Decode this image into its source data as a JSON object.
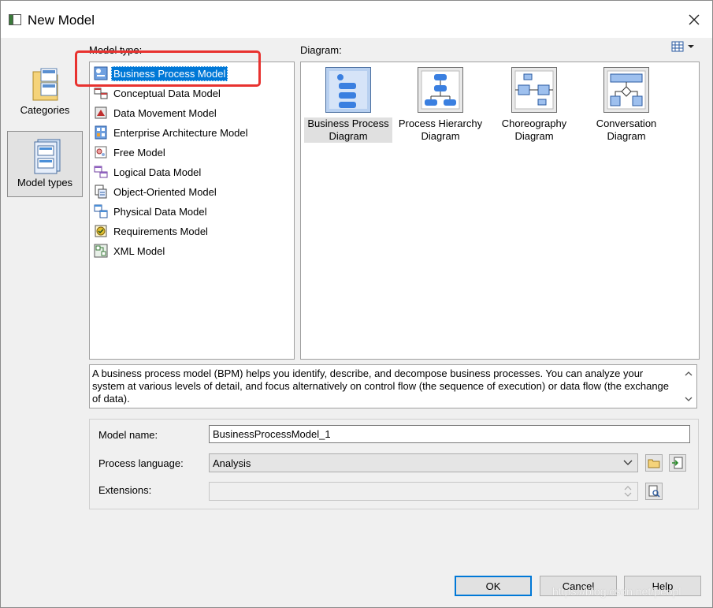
{
  "window": {
    "title": "New Model"
  },
  "sidebar": {
    "categories": [
      {
        "label": "Categories",
        "selected": false
      },
      {
        "label": "Model types",
        "selected": true
      }
    ]
  },
  "model_type": {
    "label": "Model type:",
    "items": [
      {
        "label": "Business Process Model",
        "icon": "bpm-icon",
        "selected": true
      },
      {
        "label": "Conceptual Data Model",
        "icon": "cdm-icon"
      },
      {
        "label": "Data Movement Model",
        "icon": "dmm-icon"
      },
      {
        "label": "Enterprise Architecture Model",
        "icon": "eam-icon"
      },
      {
        "label": "Free Model",
        "icon": "free-model-icon"
      },
      {
        "label": "Logical Data Model",
        "icon": "ldm-icon"
      },
      {
        "label": "Object-Oriented Model",
        "icon": "oom-icon"
      },
      {
        "label": "Physical Data Model",
        "icon": "pdm-icon"
      },
      {
        "label": "Requirements Model",
        "icon": "requirements-icon"
      },
      {
        "label": "XML Model",
        "icon": "xml-icon"
      }
    ]
  },
  "diagram": {
    "label": "Diagram:",
    "items": [
      {
        "line1": "Business Process",
        "line2": "Diagram",
        "selected": true
      },
      {
        "line1": "Process Hierarchy",
        "line2": "Diagram"
      },
      {
        "line1": "Choreography",
        "line2": "Diagram"
      },
      {
        "line1": "Conversation",
        "line2": "Diagram"
      }
    ]
  },
  "description": "A business process model (BPM) helps you identify, describe, and decompose business processes. You can analyze your system at various levels of detail, and focus alternatively on control flow (the sequence of execution) or data flow (the exchange of data).",
  "form": {
    "model_name_label": "Model name:",
    "model_name_value": "BusinessProcessModel_1",
    "process_language_label": "Process language:",
    "process_language_value": "Analysis",
    "extensions_label": "Extensions:",
    "extensions_value": ""
  },
  "buttons": {
    "ok": "OK",
    "cancel": "Cancel",
    "help": "Help"
  },
  "watermark": "https://blog.csdn.net/peopl",
  "colors": {
    "selection": "#0078d7",
    "annotation": "#e8322f"
  }
}
